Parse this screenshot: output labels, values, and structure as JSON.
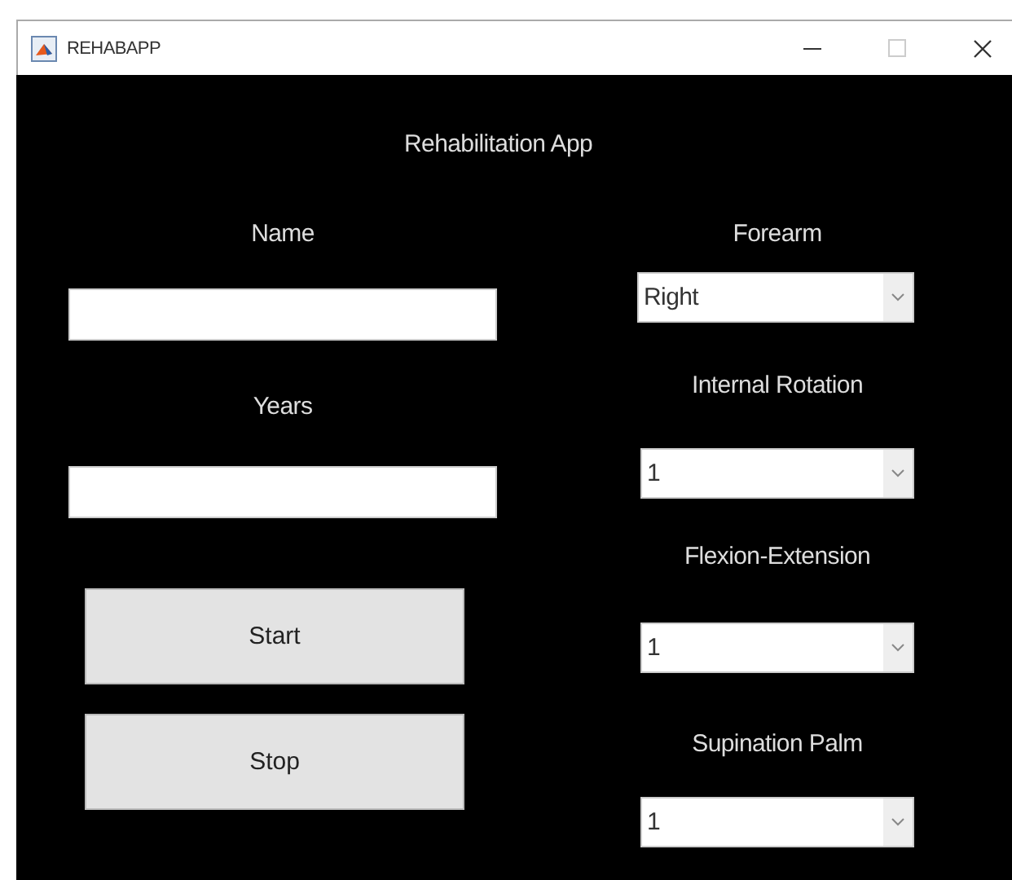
{
  "window": {
    "title": "REHABAPP",
    "maximize_disabled": true
  },
  "app_title": "Rehabilitation App",
  "text_fields": [
    {
      "label": "Name"
    },
    {
      "label": "Years"
    }
  ],
  "buttons": [
    "Start",
    "Stop"
  ],
  "dropdowns": [
    {
      "label": "Forearm",
      "value": "Right"
    },
    {
      "label": "Internal Rotation",
      "value": "1"
    },
    {
      "label": "Flexion-Extension",
      "value": "1"
    },
    {
      "label": "Supination Palm",
      "value": "1"
    }
  ]
}
